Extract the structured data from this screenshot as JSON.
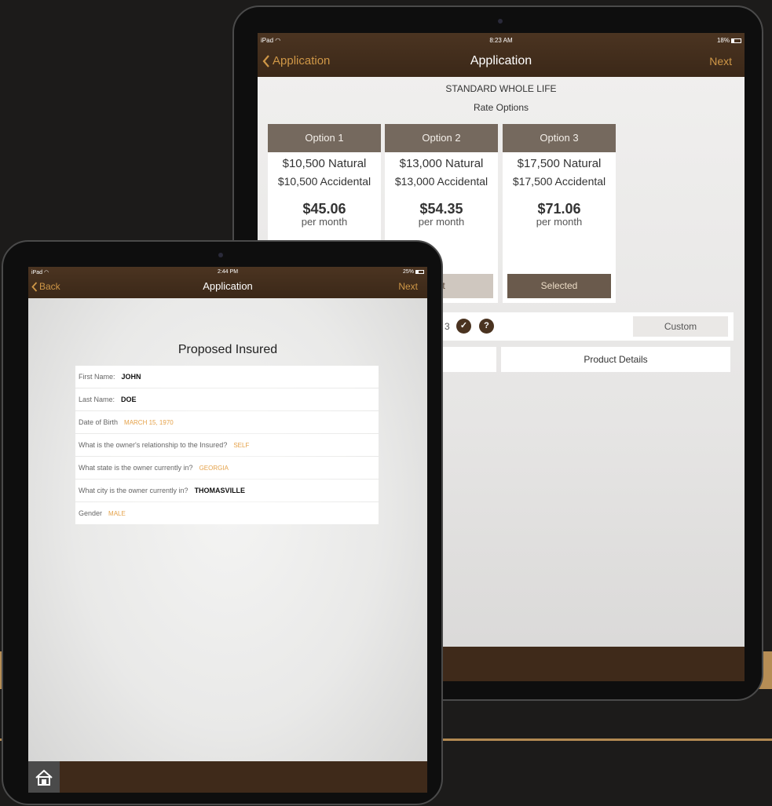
{
  "back_tablet": {
    "status": {
      "carrier": "iPad",
      "time": "8:23 AM",
      "battery": "18%"
    },
    "nav": {
      "back_label": "Application",
      "title": "Application",
      "next_label": "Next"
    },
    "product_title": "STANDARD WHOLE LIFE",
    "section_title": "Rate Options",
    "options": [
      {
        "header": "Option 1",
        "natural": "$10,500 Natural",
        "accidental": "$10,500 Accidental",
        "price": "$45.06",
        "period": "per month",
        "button": ""
      },
      {
        "header": "Option 2",
        "natural": "$13,000 Natural",
        "accidental": "$13,000 Accidental",
        "price": "$54.35",
        "period": "per month",
        "button": "ct"
      },
      {
        "header": "Option 3",
        "natural": "$17,500 Natural",
        "accidental": "$17,500 Accidental",
        "price": "$71.06",
        "period": "per month",
        "button": "Selected"
      }
    ],
    "partial_label": "3",
    "custom_button": "Custom",
    "product_details_button": "Product Details"
  },
  "front_tablet": {
    "status": {
      "carrier": "iPad",
      "time": "2:44 PM",
      "battery": "25%"
    },
    "nav": {
      "back_label": "Back",
      "title": "Application",
      "next_label": "Next"
    },
    "form_title": "Proposed Insured",
    "fields": [
      {
        "label": "First Name:",
        "value": "JOHN",
        "style": "dark"
      },
      {
        "label": "Last Name:",
        "value": "DOE",
        "style": "dark"
      },
      {
        "label": "Date of Birth",
        "value": "MARCH 15, 1970",
        "style": "orange"
      },
      {
        "label": "What is the owner's relationship to the Insured?",
        "value": "SELF",
        "style": "orange"
      },
      {
        "label": "What state is the owner currently in?",
        "value": "GEORGIA",
        "style": "orange"
      },
      {
        "label": "What city is the owner currently in?",
        "value": "THOMASVILLE",
        "style": "dark"
      },
      {
        "label": "Gender",
        "value": "MALE",
        "style": "orange"
      }
    ]
  },
  "colors": {
    "nav_bar": "#3f2a1a",
    "accent_orange": "#cf9747",
    "option_header": "#75695e",
    "background_gold": "#b68d55"
  }
}
